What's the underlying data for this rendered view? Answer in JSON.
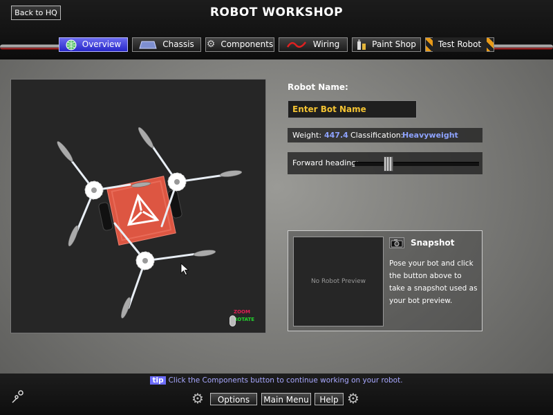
{
  "header": {
    "title": "ROBOT WORKSHOP",
    "back_label": "Back to HQ"
  },
  "tabs": [
    {
      "label": "Overview",
      "icon": "globe-icon",
      "active": true
    },
    {
      "label": "Chassis",
      "icon": "chassis-icon",
      "active": false
    },
    {
      "label": "Components",
      "icon": "gear-icon",
      "active": false
    },
    {
      "label": "Wiring",
      "icon": "wire-icon",
      "active": false
    },
    {
      "label": "Paint Shop",
      "icon": "paint-icon",
      "active": false
    },
    {
      "label": "Test Robot",
      "icon": "",
      "active": false
    }
  ],
  "viewport": {
    "zoom_label": "ZOOM",
    "rotate_label": "ROTATE"
  },
  "robot": {
    "name_label": "Robot Name:",
    "name_value": "Enter Bot Name",
    "weight_label": "Weight:",
    "weight_value": "447.4",
    "class_label": "Classification:",
    "class_value": "Heavyweight",
    "heading_label": "Forward heading:",
    "heading_fraction": 0.27
  },
  "snapshot": {
    "title": "Snapshot",
    "preview_text": "No Robot Preview",
    "description": "Pose your bot and click the button above to take a snapshot used as your bot preview."
  },
  "footer": {
    "tip_tag": "tip",
    "tip_text": "Click the Components button to continue working on your robot.",
    "options_label": "Options",
    "mainmenu_label": "Main Menu",
    "help_label": "Help"
  },
  "colors": {
    "accent_blue": "#3838d8",
    "name_yellow": "#f2c232",
    "stat_blue": "#8ea3ff",
    "chassis_red": "#dd5642"
  }
}
